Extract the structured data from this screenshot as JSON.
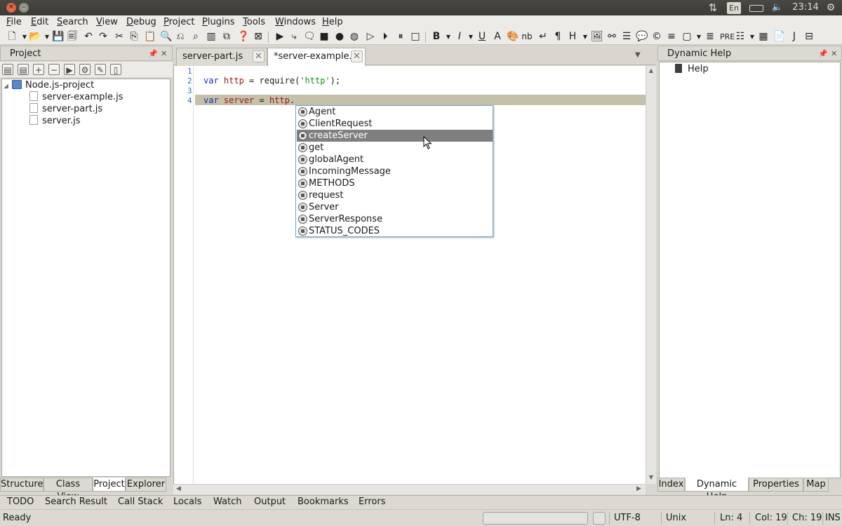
{
  "system": {
    "keyboard": "En",
    "clock": "23:14"
  },
  "menu": [
    "File",
    "Edit",
    "Search",
    "View",
    "Debug",
    "Project",
    "Plugins",
    "Tools",
    "Windows",
    "Help"
  ],
  "project_panel": {
    "title": "Project",
    "root": "Node.js-project",
    "files": [
      "server-example.js",
      "server-part.js",
      "server.js"
    ],
    "tabs": [
      "Structure",
      "Class View",
      "Project",
      "Explorer"
    ],
    "active_tab": "Project"
  },
  "editor": {
    "tabs": [
      {
        "label": "server-part.js",
        "active": false
      },
      {
        "label": "*server-example.js",
        "active": true
      }
    ],
    "line_numbers": [
      "1",
      "2",
      "3",
      "4"
    ],
    "line2": {
      "kw": "var",
      "name": "http",
      "mid": " = require(",
      "str": "'http'",
      "end": ");"
    },
    "line4": {
      "kw": "var",
      "name": "server",
      "mid": " = ",
      "obj": "http",
      "dot": "."
    }
  },
  "completion": {
    "items": [
      "Agent",
      "ClientRequest",
      "createServer",
      "get",
      "globalAgent",
      "IncomingMessage",
      "METHODS",
      "request",
      "Server",
      "ServerResponse",
      "STATUS_CODES"
    ],
    "selected": "createServer"
  },
  "help_panel": {
    "title": "Dynamic Help",
    "item": "Help",
    "tabs": [
      "Index",
      "Dynamic Help",
      "Properties",
      "Map"
    ],
    "active_tab": "Dynamic Help"
  },
  "bottom_tabs": [
    "TODO",
    "Search Result",
    "Call Stack",
    "Locals",
    "Watch",
    "Output",
    "Bookmarks",
    "Errors"
  ],
  "status": {
    "message": "Ready",
    "encoding": "UTF-8",
    "line_ending": "Unix",
    "line": "Ln: 4",
    "col": "Col: 19",
    "ch": "Ch: 19",
    "mode": "INS"
  },
  "colors": {
    "keyword": "#1a2fb0",
    "identifier": "#a01a1a",
    "string": "#1a8a1a",
    "line_numbers": "#2a6fd0",
    "current_line": "#c4c0a9",
    "selection": "#7f7f7f"
  }
}
